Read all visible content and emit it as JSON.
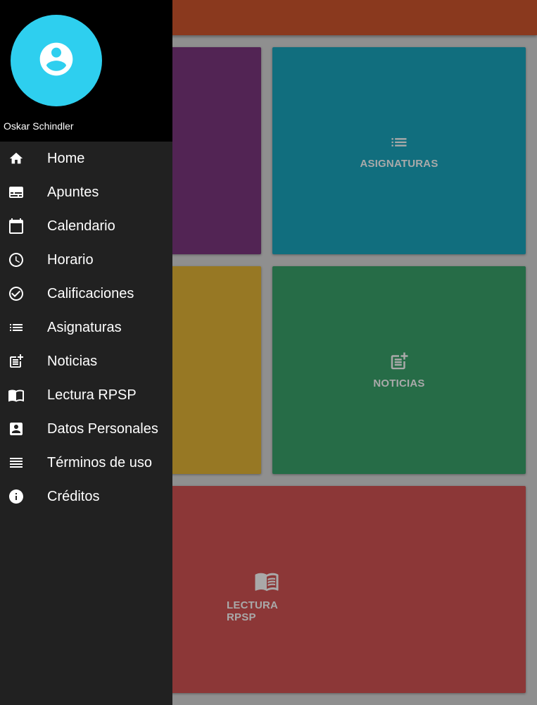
{
  "drawer": {
    "user_name": "Oskar Schindler",
    "avatar_icon": "account-circle-icon",
    "avatar_color": "#2ecfef",
    "items": [
      {
        "label": "Home",
        "icon": "home-icon"
      },
      {
        "label": "Apuntes",
        "icon": "subtitles-icon"
      },
      {
        "label": "Calendario",
        "icon": "calendar-icon"
      },
      {
        "label": "Horario",
        "icon": "clock-icon"
      },
      {
        "label": "Calificaciones",
        "icon": "check-circle-icon"
      },
      {
        "label": "Asignaturas",
        "icon": "list-icon"
      },
      {
        "label": "Noticias",
        "icon": "post-add-icon"
      },
      {
        "label": "Lectura RPSP",
        "icon": "menu-book-icon"
      },
      {
        "label": "Datos Personales",
        "icon": "contact-card-icon"
      },
      {
        "label": "Términos de uso",
        "icon": "lines-icon"
      },
      {
        "label": "Créditos",
        "icon": "info-icon"
      }
    ]
  },
  "tiles": {
    "asignaturas": {
      "label": "ASIGNATURAS",
      "icon": "list-icon",
      "color": "#116e7e"
    },
    "noticias": {
      "label": "NOTICIAS",
      "icon": "post-add-icon",
      "color": "#266c47"
    },
    "lectura": {
      "label": "LECTURA RPSP",
      "icon": "menu-book-icon",
      "color": "#8c3737"
    },
    "purple_color": "#522454",
    "mustard_color": "#977824"
  },
  "topbar_color": "#8a391e"
}
